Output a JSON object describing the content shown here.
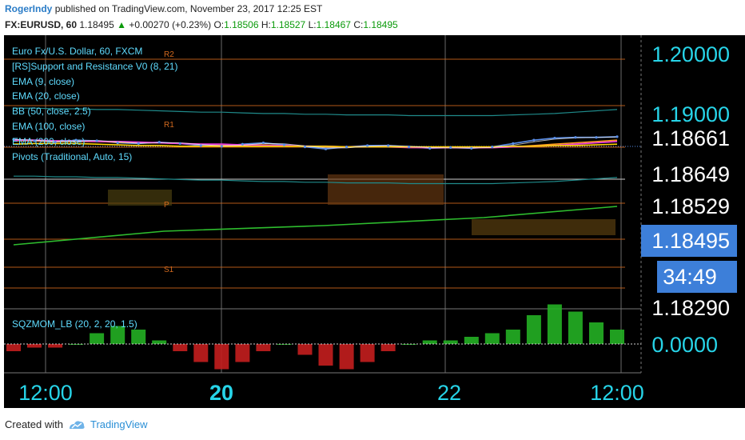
{
  "header": {
    "author": "RogerIndy",
    "published_text": "published on TradingView.com, November 23, 2017 12:25 EST",
    "symbol": "FX:EURUSD, 60",
    "last": "1.18495",
    "change_arrow": "▲",
    "change": "+0.00270 (+0.23%)",
    "open_label": "O:",
    "open": "1.18506",
    "high_label": "H:",
    "high": "1.18527",
    "low_label": "L:",
    "low": "1.18467",
    "close_label": "C:",
    "close": "1.18495"
  },
  "legend": [
    "Euro Fx/U.S. Dollar, 60, FXCM",
    "[RS]Support and Resistance V0 (8, 21)",
    "EMA (9, close)",
    "EMA (20, close)",
    "BB (50, close, 2.5)",
    "EMA (100, close)",
    "EMA (200, close)",
    "Pivots (Traditional, Auto, 15)"
  ],
  "pivot_labels": {
    "r1": "R1",
    "p": "P",
    "s1": "S1",
    "r2": "R2"
  },
  "price_axis": {
    "labels": [
      "1.20000",
      "1.19000",
      "1.18661",
      "1.18649",
      "1.18529",
      "1.18290"
    ],
    "current_price": "1.18495",
    "countdown": "34:49"
  },
  "time_axis": {
    "labels": [
      "12:00",
      "20",
      "22",
      "12:00"
    ]
  },
  "oscillator": {
    "label": "SQZMOM_LB (20, 2, 20, 1.5)",
    "zero_label": "0.0000"
  },
  "colors": {
    "price": "#5a8ee8",
    "ema9": "#ffffff",
    "ema20": "#ff9d1c",
    "ema100": "#e43bd8",
    "ema200": "#ffd400",
    "bb": "#1f8a8a",
    "bb_mid": "#c0392b",
    "pivot": "#d2691e",
    "axis_text": "#27d4e8",
    "price_tag": "#3d7fd9"
  },
  "chart_data": {
    "type": "line",
    "title": "Euro Fx/U.S. Dollar, 60, FXCM",
    "series": [
      {
        "name": "Euro Fx/U.S. Dollar, 60, FXCM",
        "values": [
          1.1862,
          1.186,
          1.1858,
          1.1861,
          1.186,
          1.1857,
          1.1856,
          1.1858,
          1.1856,
          1.1853,
          1.1852,
          1.1855,
          1.1857,
          1.1854,
          1.1851,
          1.1848,
          1.1851,
          1.1853,
          1.1853,
          1.1851,
          1.1849,
          1.185,
          1.1849,
          1.1851,
          1.1856,
          1.1861,
          1.1864,
          1.1865,
          1.1865,
          1.1866
        ]
      },
      {
        "name": "EMA (20, close)",
        "values": [
          1.186,
          1.186,
          1.1859,
          1.1859,
          1.1859,
          1.1858,
          1.1857,
          1.1857,
          1.1856,
          1.1855,
          1.1854,
          1.1854,
          1.1854,
          1.1853,
          1.1852,
          1.1851,
          1.1851,
          1.1851,
          1.1851,
          1.1851,
          1.185,
          1.185,
          1.185,
          1.185,
          1.1851,
          1.1853,
          1.1855,
          1.1857,
          1.1859,
          1.1861
        ]
      },
      {
        "name": "EMA (100, close)",
        "values": [
          1.1861,
          1.1861,
          1.186,
          1.186,
          1.1859,
          1.1859,
          1.1858,
          1.1857,
          1.1856,
          1.1855,
          1.1855,
          1.1854,
          1.1853,
          1.1853,
          1.1852,
          1.1852,
          1.1851,
          1.1851,
          1.1851,
          1.185,
          1.185,
          1.185,
          1.185,
          1.185,
          1.1851,
          1.1852,
          1.1853,
          1.1855,
          1.1857,
          1.1859
        ]
      },
      {
        "name": "EMA (200, close)",
        "values": [
          1.1855,
          1.1856,
          1.1856,
          1.1856,
          1.1855,
          1.1854,
          1.1853,
          1.1853,
          1.1852,
          1.1852,
          1.1852,
          1.1852,
          1.1852,
          1.1852,
          1.1852,
          1.1852,
          1.1851,
          1.1851,
          1.1851,
          1.1851,
          1.1851,
          1.1851,
          1.1851,
          1.1851,
          1.1852,
          1.1852,
          1.1853,
          1.1853,
          1.1854,
          1.1855
        ]
      },
      {
        "name": "SQZMOM_LB (20, 2, 20, 1.5)",
        "values": [
          -0.0002,
          -0.0001,
          -0.0001,
          0.0,
          0.0003,
          0.0005,
          0.0004,
          0.0001,
          -0.0002,
          -0.0005,
          -0.0007,
          -0.0005,
          -0.0002,
          0.0,
          -0.0003,
          -0.0006,
          -0.0007,
          -0.0005,
          -0.0002,
          0.0,
          0.0001,
          0.0001,
          0.0002,
          0.0003,
          0.0004,
          0.0008,
          0.0011,
          0.0009,
          0.0006,
          0.0004
        ]
      }
    ],
    "ylim": [
      1.1829,
      1.2005
    ]
  }
}
